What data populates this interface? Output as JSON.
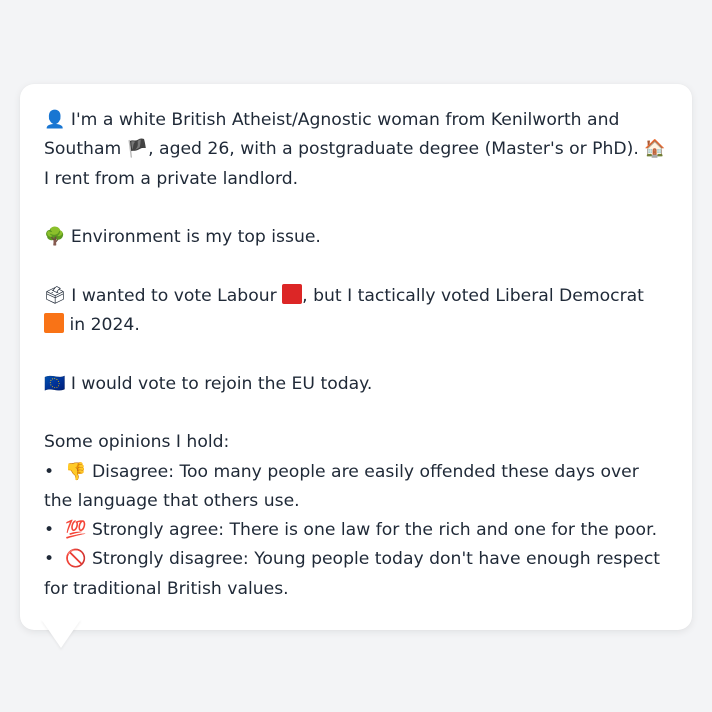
{
  "profile": {
    "identity": {
      "icon": "bust-icon",
      "icon_char": "👤",
      "text_a": " I'm a white British Atheist/Agnostic woman from Kenilworth and Southam ",
      "flag": "england-flag-icon",
      "flag_char": "🏴",
      "text_b": ", aged 26, with a postgraduate degree (Master's or PhD). ",
      "house": "house-icon",
      "house_char": "🏠",
      "text_c": " I rent from a private landlord."
    },
    "top_issue": {
      "icon": "tree-icon",
      "icon_char": "🌳",
      "text": " Environment is my top issue."
    },
    "vote": {
      "icon": "ballot-box-icon",
      "icon_char": "🗳",
      "text_a": " I wanted to vote Labour ",
      "labour_color": "#dc2626",
      "text_b": ", but I tactically voted Liberal Democrat ",
      "libdem_color": "#f97316",
      "text_c": " in 2024."
    },
    "eu": {
      "icon": "eu-flag-icon",
      "icon_char": "🇪🇺",
      "text": " I would vote to rejoin the EU today."
    },
    "opinions_heading": "Some opinions I hold:",
    "opinions": [
      {
        "icon": "thumbs-down-icon",
        "icon_char": "👎",
        "text": " Disagree: Too many people are easily offended these days over the language that others use."
      },
      {
        "icon": "hundred-points-icon",
        "icon_char": "💯",
        "text": " Strongly agree: There is one law for the rich and one for the poor."
      },
      {
        "icon": "prohibited-icon",
        "icon_char": "🚫",
        "text": " Strongly disagree: Young people today don't have enough respect for traditional British values."
      }
    ]
  },
  "colors": {
    "page_bg": "#f3f4f6",
    "bubble_bg": "#ffffff",
    "text": "#1f2937"
  }
}
